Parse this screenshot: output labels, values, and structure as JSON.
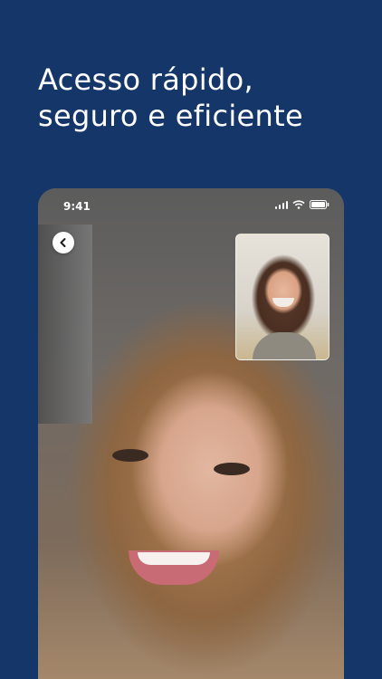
{
  "headline": {
    "line1": "Acesso rápido,",
    "line2": "seguro e eficiente"
  },
  "phone": {
    "status_bar": {
      "time": "9:41",
      "icons": [
        "cellular-signal-icon",
        "wifi-icon",
        "battery-icon"
      ]
    },
    "back_button_icon": "chevron-left-icon",
    "main_video": "remote-participant-video",
    "pip_video": "self-view-video"
  },
  "colors": {
    "background": "#153669",
    "headline_text": "#ffffff"
  }
}
